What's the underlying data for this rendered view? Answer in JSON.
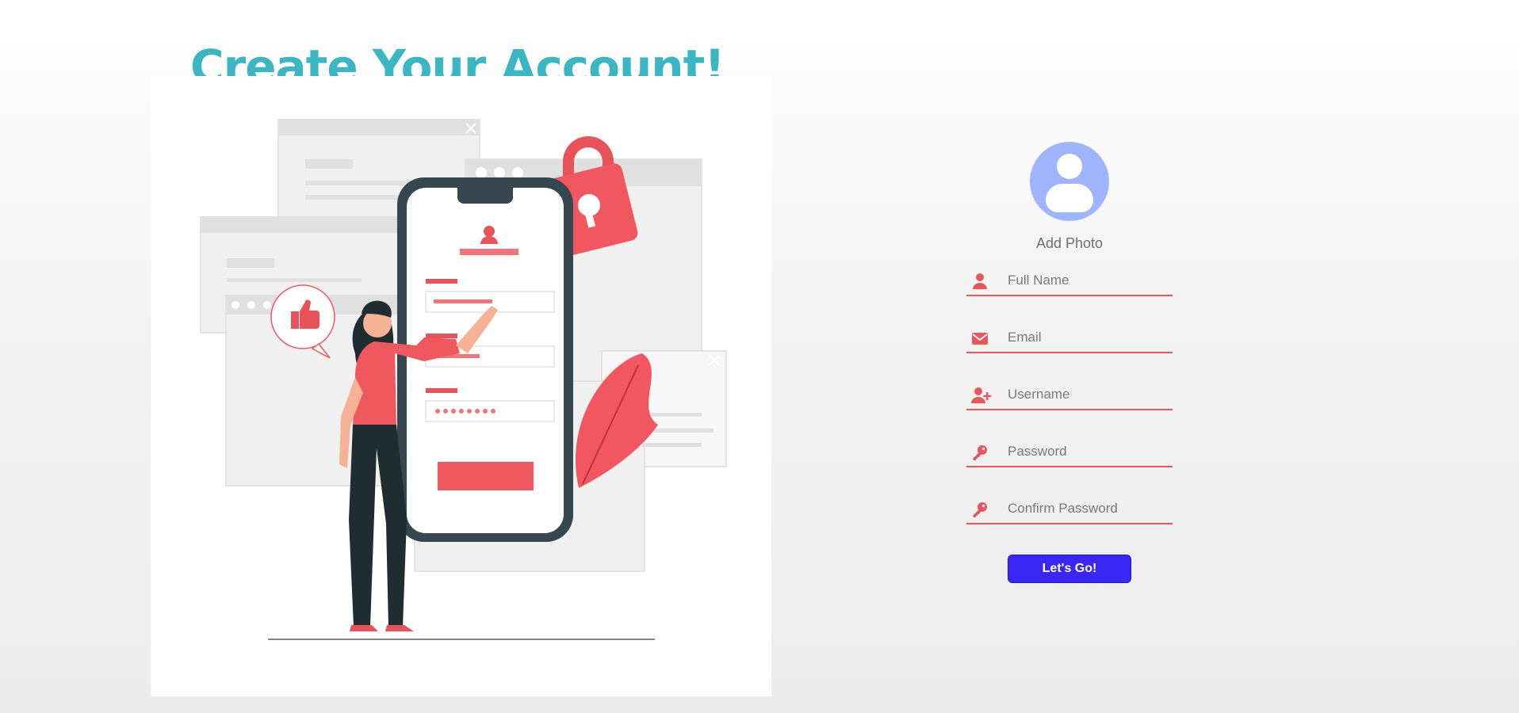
{
  "page": {
    "title": "Create Your Account!"
  },
  "form": {
    "add_photo_label": "Add Photo",
    "fields": [
      {
        "icon": "user-icon",
        "placeholder": "Full Name",
        "value": ""
      },
      {
        "icon": "envelope-icon",
        "placeholder": "Email",
        "value": ""
      },
      {
        "icon": "user-plus-icon",
        "placeholder": "Username",
        "value": ""
      },
      {
        "icon": "key-icon",
        "placeholder": "Password",
        "value": ""
      },
      {
        "icon": "key-icon",
        "placeholder": "Confirm Password",
        "value": ""
      }
    ],
    "submit_label": "Let's Go!"
  },
  "colors": {
    "title": "#3bb7c4",
    "accent": "#e8565a",
    "button": "#3a27f5",
    "avatar": "#9fb4ff"
  }
}
